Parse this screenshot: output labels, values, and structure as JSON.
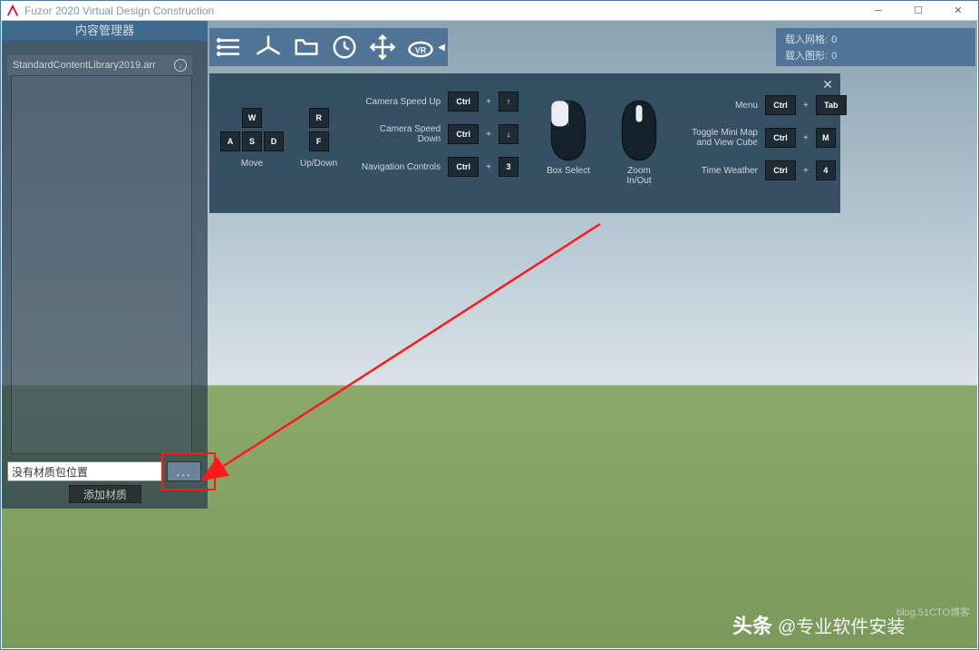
{
  "window": {
    "title": "Fuzor 2020 Virtual Design Construction"
  },
  "content_manager": {
    "header": "内容管理器",
    "library_name": "StandardContentLibrary2019.arr",
    "path_placeholder": "没有材质包位置",
    "browse_label": "...",
    "add_label": "添加材质"
  },
  "stats": {
    "grids_label": "载入网格:",
    "grids_value": "0",
    "shapes_label": "载入图形:",
    "shapes_value": "0"
  },
  "controls": {
    "move_label": "Move",
    "updown_label": "Up/Down",
    "rows": {
      "speed_up": "Camera Speed Up",
      "speed_down": "Camera Speed Down",
      "nav": "Navigation Controls",
      "menu": "Menu",
      "minimap": "Toggle Mini Map\nand View Cube",
      "time": "Time Weather"
    },
    "keys": {
      "ctrl": "Ctrl",
      "tab": "Tab",
      "m": "M",
      "three": "3",
      "four": "4",
      "w": "W",
      "a": "A",
      "s": "S",
      "d": "D",
      "r": "R",
      "f": "F",
      "up": "↑",
      "down": "↓"
    },
    "mouse": {
      "box_select": "Box Select",
      "zoom": "Zoom\nIn/Out"
    }
  },
  "watermark": {
    "brand": "头条",
    "at": "@专业软件安装",
    "blog": "blog.51CTO博客"
  }
}
